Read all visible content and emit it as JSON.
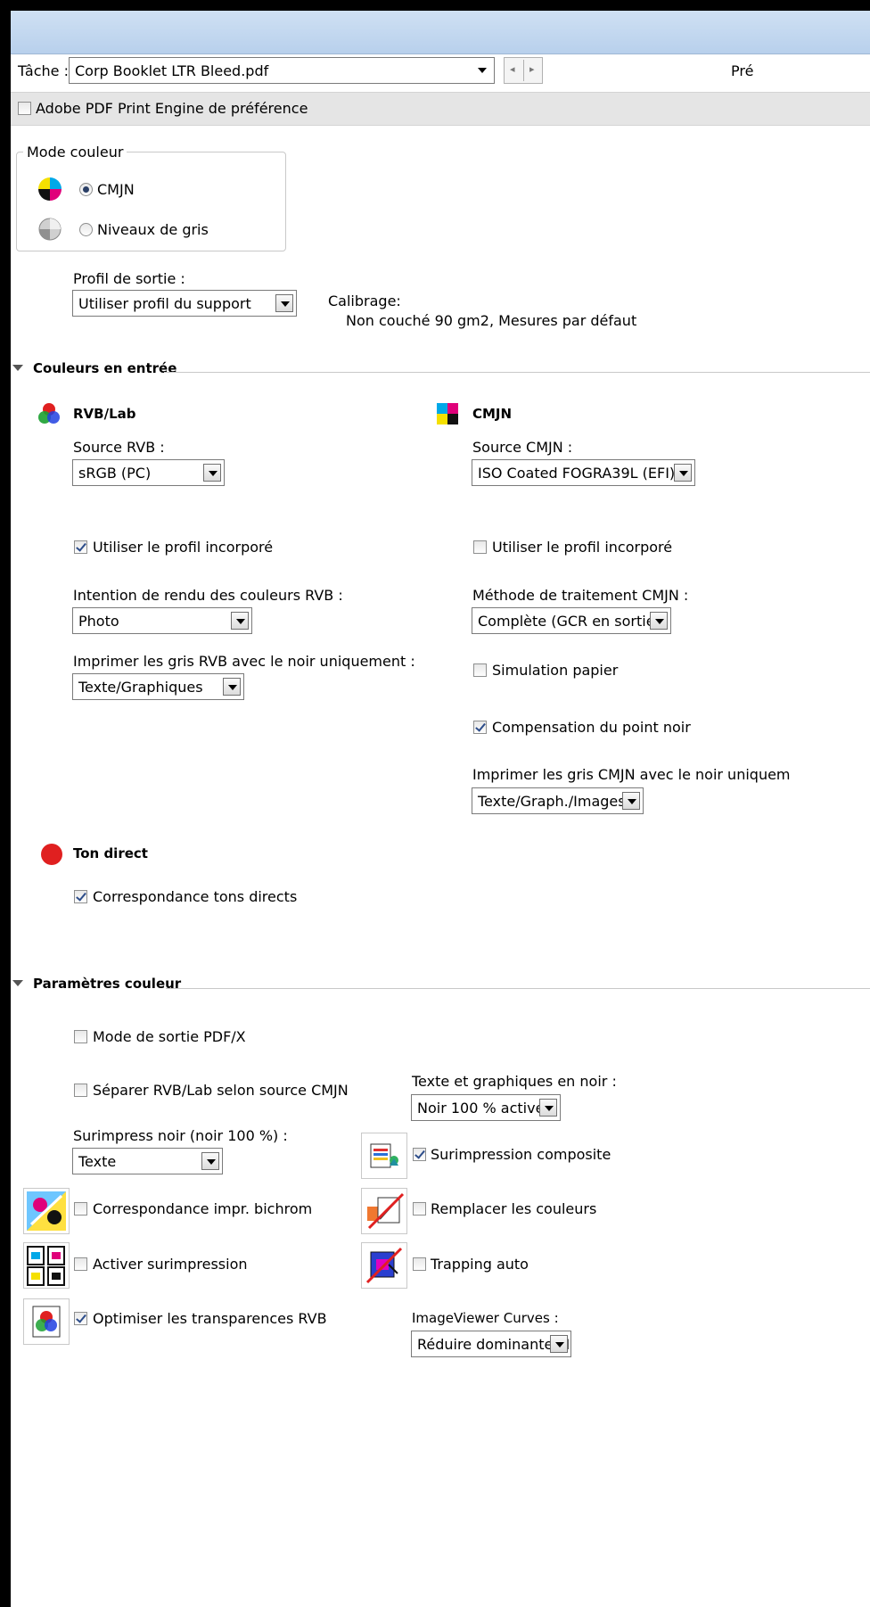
{
  "header": {
    "task_label": "Tâche :",
    "task_value": "Corp Booklet LTR Bleed.pdf",
    "right_cut_label": "Pré",
    "engine_label": "Adobe PDF Print Engine de préférence",
    "engine_checked": false
  },
  "color_mode": {
    "legend": "Mode couleur",
    "options": [
      {
        "label": "CMJN",
        "selected": true
      },
      {
        "label": "Niveaux de gris",
        "selected": false
      }
    ]
  },
  "output_profile": {
    "label": "Profil de sortie :",
    "value": "Utiliser profil du support",
    "calibration_label": "Calibrage:",
    "calibration_value": "Non couché 90 gm2, Mesures par défaut"
  },
  "input_colors": {
    "section_title": "Couleurs en entrée",
    "rgb": {
      "title": "RVB/Lab",
      "source_label": "Source RVB :",
      "source_value": "sRGB (PC)",
      "embedded_label": "Utiliser le profil incorporé",
      "embedded_checked": true,
      "intent_label": "Intention de rendu des couleurs RVB :",
      "intent_value": "Photo",
      "gray_label": "Imprimer les gris RVB avec le noir uniquement :",
      "gray_value": "Texte/Graphiques"
    },
    "cmyk": {
      "title": "CMJN",
      "source_label": "Source CMJN :",
      "source_value": "ISO Coated FOGRA39L (EFI)",
      "embedded_label": "Utiliser le profil incorporé",
      "embedded_checked": false,
      "method_label": "Méthode de traitement CMJN :",
      "method_value": "Complète (GCR en sortie)",
      "paper_sim_label": "Simulation papier",
      "paper_sim_checked": false,
      "bpc_label": "Compensation du point noir",
      "bpc_checked": true,
      "gray_label": "Imprimer les gris CMJN avec le noir uniquem",
      "gray_value": "Texte/Graph./Images"
    },
    "spot": {
      "title": "Ton direct",
      "match_label": "Correspondance tons directs",
      "match_checked": true
    }
  },
  "color_params": {
    "section_title": "Paramètres couleur",
    "pdfx_label": "Mode de sortie PDF/X",
    "pdfx_checked": false,
    "separate_label": "Séparer RVB/Lab selon source CMJN",
    "separate_checked": false,
    "text_black_label": "Texte et graphiques en noir :",
    "text_black_value": "Noir 100 % activé",
    "overprint_black_label": "Surimpress noir (noir 100 %) :",
    "overprint_black_value": "Texte",
    "composite_label": "Surimpression composite",
    "composite_checked": true,
    "two_color_label": "Correspondance impr. bichrom",
    "two_color_checked": false,
    "replace_label": "Remplacer les couleurs",
    "replace_checked": false,
    "enable_overprint_label": "Activer surimpression",
    "enable_overprint_checked": false,
    "trapping_label": "Trapping auto",
    "trapping_checked": false,
    "optimize_label": "Optimiser les transparences RVB",
    "optimize_checked": true,
    "curves_label": "ImageViewer Curves :",
    "curves_value": "Réduire dominante M"
  },
  "colors": {
    "spot_red": "#e02020",
    "title_bar": "#c4d8ef"
  }
}
